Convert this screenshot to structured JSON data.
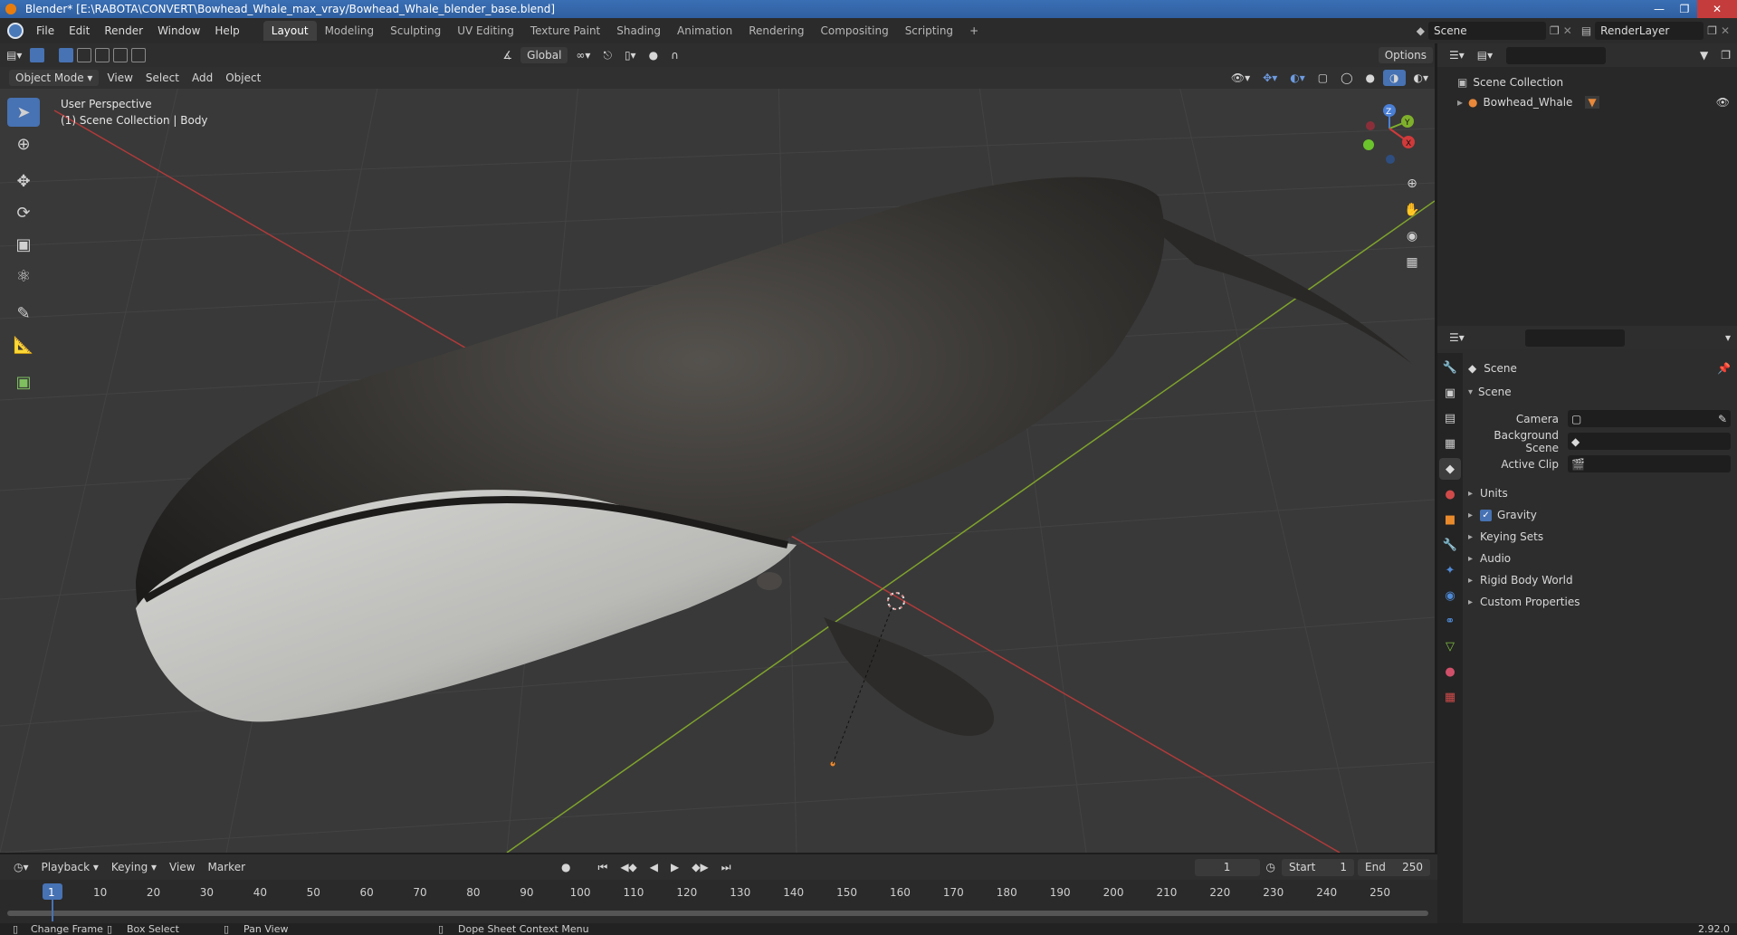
{
  "window": {
    "title": "Blender* [E:\\RABOTA\\CONVERT\\Bowhead_Whale_max_vray/Bowhead_Whale_blender_base.blend]"
  },
  "topbar": {
    "menus": [
      "File",
      "Edit",
      "Render",
      "Window",
      "Help"
    ],
    "workspaces": [
      "Layout",
      "Modeling",
      "Sculpting",
      "UV Editing",
      "Texture Paint",
      "Shading",
      "Animation",
      "Rendering",
      "Compositing",
      "Scripting"
    ],
    "active_workspace": "Layout",
    "add_tab": "+",
    "scene_name": "Scene",
    "render_layer": "RenderLayer"
  },
  "viewport_header": {
    "mode": "Object Mode",
    "menus": [
      "View",
      "Select",
      "Add",
      "Object"
    ],
    "orientation": "Global",
    "options": "Options"
  },
  "viewport": {
    "perspective": "User Perspective",
    "collection_info": "(1) Scene Collection | Body",
    "gizmo_axes": [
      "X",
      "Y",
      "Z"
    ]
  },
  "outliner": {
    "root": "Scene Collection",
    "items": [
      {
        "label": "Bowhead_Whale"
      }
    ]
  },
  "properties": {
    "context": "Scene",
    "panel": "Scene",
    "fields": [
      {
        "label": "Camera",
        "value": ""
      },
      {
        "label": "Background Scene",
        "value": ""
      },
      {
        "label": "Active Clip",
        "value": ""
      }
    ],
    "sections": [
      "Units",
      "Gravity",
      "Keying Sets",
      "Audio",
      "Rigid Body World",
      "Custom Properties"
    ],
    "gravity_checked": true
  },
  "timeline": {
    "menus": [
      "Playback",
      "Keying",
      "View",
      "Marker"
    ],
    "current_frame": "1",
    "start_label": "Start",
    "start": "1",
    "end_label": "End",
    "end": "250",
    "ticks": [
      "1",
      "10",
      "20",
      "30",
      "40",
      "50",
      "60",
      "70",
      "80",
      "90",
      "100",
      "110",
      "120",
      "130",
      "140",
      "150",
      "160",
      "170",
      "180",
      "190",
      "200",
      "210",
      "220",
      "230",
      "240",
      "250"
    ]
  },
  "statusbar": {
    "items": [
      "Change Frame",
      "Box Select",
      "Pan View",
      "Dope Sheet Context Menu"
    ],
    "version": "2.92.0"
  }
}
